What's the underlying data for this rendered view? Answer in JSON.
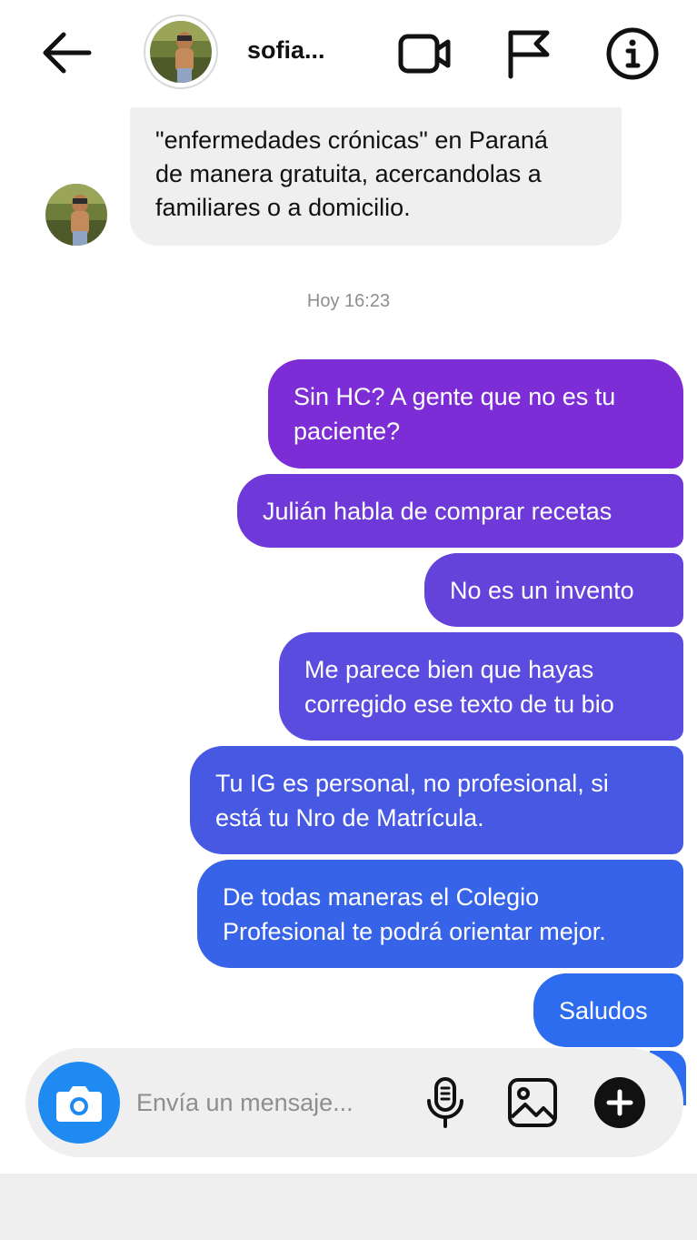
{
  "header": {
    "username": "sofia...",
    "icons": [
      "back-arrow-icon",
      "video-call-icon",
      "flag-icon",
      "info-icon"
    ]
  },
  "incoming_message": {
    "lines": [
      "\"enfermedades crónicas\" en Paraná",
      "de manera gratuita, acercandolas a",
      "familiares o a domicilio."
    ]
  },
  "timestamp": "Hoy 16:23",
  "outgoing_messages": [
    {
      "lines": [
        "Sin HC? A gente que no es tu",
        "paciente?"
      ]
    },
    {
      "lines": [
        "Julián habla de comprar recetas"
      ]
    },
    {
      "lines": [
        "No es un invento"
      ]
    },
    {
      "lines": [
        "Me parece bien que hayas",
        "corregido ese texto de tu bio"
      ]
    },
    {
      "lines": [
        "Tu IG es personal, no profesional, si",
        "está tu Nro de Matrícula."
      ]
    },
    {
      "lines": [
        "De todas maneras el Colegio",
        "Profesional te podrá orientar mejor."
      ]
    },
    {
      "lines": [
        "Saludos"
      ]
    }
  ],
  "composer": {
    "placeholder": "Envía un mensaje...",
    "icons": [
      "camera-icon",
      "microphone-icon",
      "gallery-icon",
      "plus-icon"
    ]
  },
  "colors": {
    "bubble_gradient_top": "#7b2fd6",
    "bubble_gradient_bottom": "#2a6ef2",
    "incoming_bubble": "#efefef",
    "camera_button": "#1f8bf2",
    "timestamp_text": "#8e8e8e"
  }
}
